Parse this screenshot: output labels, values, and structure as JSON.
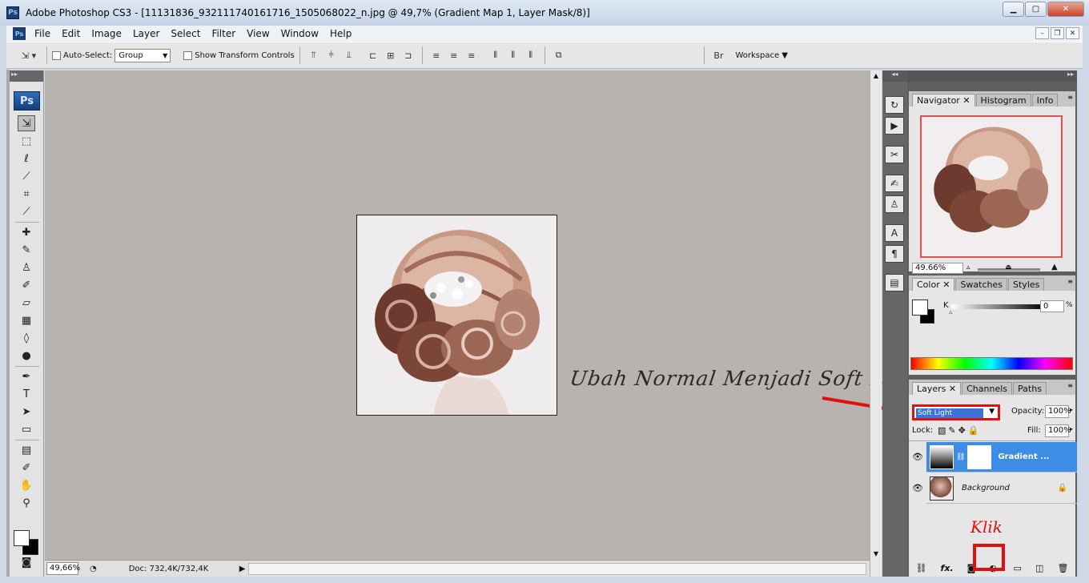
{
  "window": {
    "title": "Adobe Photoshop CS3 - [11131836_932111740161716_1505068022_n.jpg @ 49,7% (Gradient Map 1, Layer Mask/8)]",
    "app_icon": "Ps"
  },
  "menu": [
    "File",
    "Edit",
    "Image",
    "Layer",
    "Select",
    "Filter",
    "View",
    "Window",
    "Help"
  ],
  "options": {
    "auto_select_label": "Auto-Select:",
    "auto_select_value": "Group",
    "show_transform_label": "Show Transform Controls",
    "workspace_label": "Workspace"
  },
  "toolbox": {
    "badge": "Ps"
  },
  "status": {
    "zoom": "49,66%",
    "doc": "Doc: 732,4K/732,4K"
  },
  "annotation": {
    "instruction": "Ubah Normal Menjadi Soft Light",
    "click_label": "Klik"
  },
  "navigator": {
    "tabs": [
      "Navigator",
      "Histogram",
      "Info"
    ],
    "zoom": "49.66%"
  },
  "color": {
    "tabs": [
      "Color",
      "Swatches",
      "Styles"
    ],
    "channel": "K",
    "value": "0",
    "unit": "%"
  },
  "layers": {
    "tabs": [
      "Layers",
      "Channels",
      "Paths"
    ],
    "blend_mode": "Soft Light",
    "opacity_label": "Opacity:",
    "opacity_value": "100%",
    "lock_label": "Lock:",
    "fill_label": "Fill:",
    "fill_value": "100%",
    "items": [
      {
        "name": "Gradient ..."
      },
      {
        "name": "Background"
      }
    ],
    "bottom_icons": [
      "link-icon",
      "fx-icon",
      "mask-icon",
      "adjustment-icon",
      "group-icon",
      "new-layer-icon",
      "trash-icon"
    ]
  }
}
